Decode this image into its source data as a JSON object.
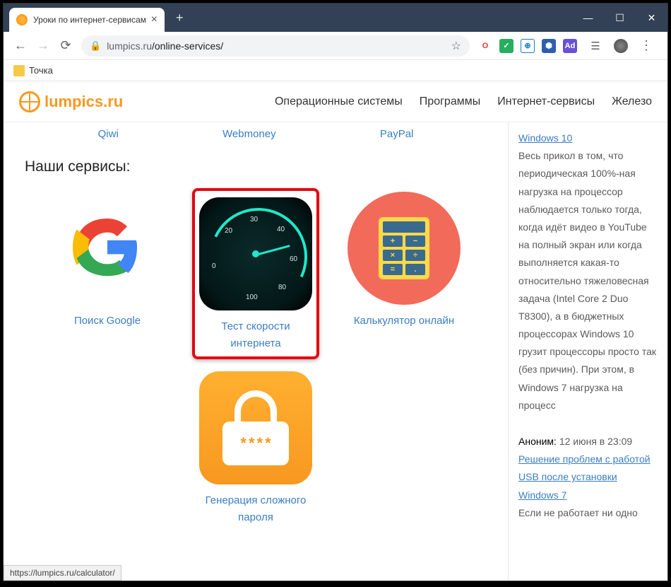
{
  "browser": {
    "tab_title": "Уроки по интернет-сервисам",
    "url_host": "lumpics.ru",
    "url_path": "/online-services/",
    "bookmark": "Точка",
    "status_url": "https://lumpics.ru/calculator/"
  },
  "site": {
    "logo": "lumpics.ru",
    "nav": [
      "Операционные системы",
      "Программы",
      "Интернет-сервисы",
      "Железо"
    ]
  },
  "money_links": [
    "Qiwi",
    "Webmoney",
    "PayPal"
  ],
  "heading": "Наши сервисы:",
  "services": [
    {
      "label": "Поиск Google"
    },
    {
      "label": "Тест скорости интернета"
    },
    {
      "label": "Калькулятор онлайн"
    },
    {
      "label": "Генерация сложного пароля"
    }
  ],
  "gauge_ticks": [
    "0",
    "20",
    "30",
    "40",
    "60",
    "80",
    "100"
  ],
  "sidebar": {
    "link1": "Windows 10",
    "text1": "Весь прикол в том, что периодическая 100%-ная нагрузка на процессор наблюдается только тогда, когда идёт видео в YouTube на полный экран или когда выполняется какая-то относительно тяжеловесная задача (Intel Core 2 Duo T8300), а в бюджетных процессорах Windows 10 грузит процессоры просто так (без причин). При этом, в Windows 7 нагрузка на процесс",
    "author": "Аноним:",
    "date": "12 июня в 23:09",
    "link2": "Решение проблем с работой USB после установки Windows 7",
    "text2": "Если не работает ни одно"
  }
}
